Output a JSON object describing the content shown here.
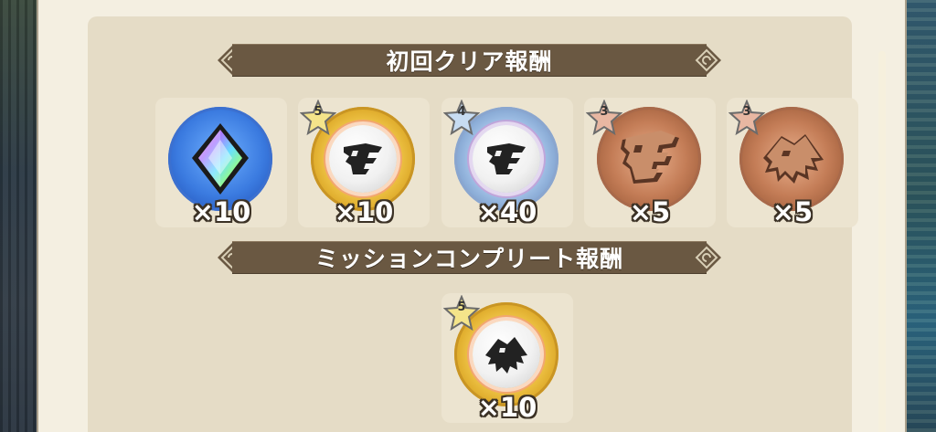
{
  "sections": [
    {
      "title": "初回クリア報酬",
      "rewards": [
        {
          "item": "rainbow-crystal-icon",
          "quantity": "×10",
          "rarity": null
        },
        {
          "item": "monster-part-medal-icon",
          "quantity": "×10",
          "rarity": "5"
        },
        {
          "item": "monster-part-medal-icon",
          "quantity": "×40",
          "rarity": "4"
        },
        {
          "item": "bronze-plate-icon",
          "quantity": "×5",
          "rarity": "3"
        },
        {
          "item": "bronze-fang-icon",
          "quantity": "×5",
          "rarity": "3"
        }
      ]
    },
    {
      "title": "ミッションコンプリート報酬",
      "rewards": [
        {
          "item": "monster-fang-medal-icon",
          "quantity": "×10",
          "rarity": "5"
        }
      ]
    }
  ],
  "colors": {
    "banner": "#6a5842",
    "panel": "#e5dcc6",
    "dialog": "#f4efe1",
    "slot": "#ece4d0"
  }
}
